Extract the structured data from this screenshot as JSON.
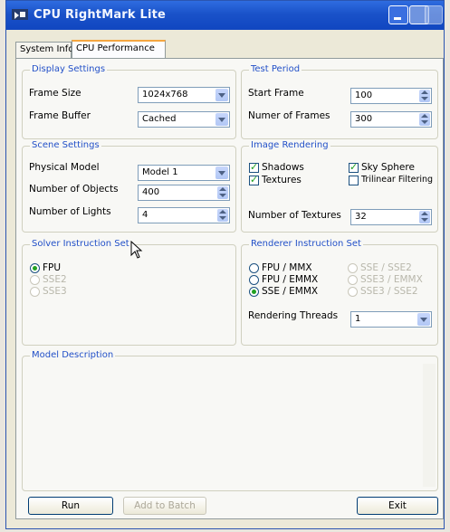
{
  "window": {
    "title": "CPU RightMark Lite"
  },
  "tabs": [
    {
      "label": "System Info"
    },
    {
      "label": "CPU Performance"
    }
  ],
  "display_settings": {
    "title": "Display Settings",
    "frame_size_label": "Frame Size",
    "frame_size_value": "1024x768",
    "frame_buffer_label": "Frame Buffer",
    "frame_buffer_value": "Cached"
  },
  "test_period": {
    "title": "Test Period",
    "start_frame_label": "Start Frame",
    "start_frame_value": "100",
    "num_frames_label": "Numer of Frames",
    "num_frames_value": "300"
  },
  "scene_settings": {
    "title": "Scene Settings",
    "physical_model_label": "Physical Model",
    "physical_model_value": "Model 1",
    "num_objects_label": "Number of Objects",
    "num_objects_value": "400",
    "num_lights_label": "Number of Lights",
    "num_lights_value": "4"
  },
  "image_rendering": {
    "title": "Image Rendering",
    "shadows_label": "Shadows",
    "shadows_checked": true,
    "sky_sphere_label": "Sky Sphere",
    "sky_sphere_checked": true,
    "textures_label": "Textures",
    "textures_checked": true,
    "trilinear_label": "Trilinear Filtering",
    "trilinear_checked": false,
    "num_textures_label": "Number of Textures",
    "num_textures_value": "32"
  },
  "solver": {
    "title": "Solver Instruction Set",
    "options": [
      "FPU",
      "SSE2",
      "SSE3"
    ],
    "selected": "FPU"
  },
  "renderer": {
    "title": "Renderer Instruction Set",
    "options_left": [
      "FPU / MMX",
      "FPU / EMMX",
      "SSE / EMMX"
    ],
    "options_right": [
      "SSE / SSE2",
      "SSE3 / EMMX",
      "SSE3 / SSE2"
    ],
    "selected": "SSE / EMMX",
    "threads_label": "Rendering Threads",
    "threads_value": "1"
  },
  "model_description": {
    "title": "Model Description"
  },
  "buttons": {
    "run": "Run",
    "add_to_batch": "Add to Batch",
    "exit": "Exit"
  },
  "colors": {
    "titlebar": "#1a52c9",
    "group_title": "#2250c8",
    "check": "#21a121"
  }
}
